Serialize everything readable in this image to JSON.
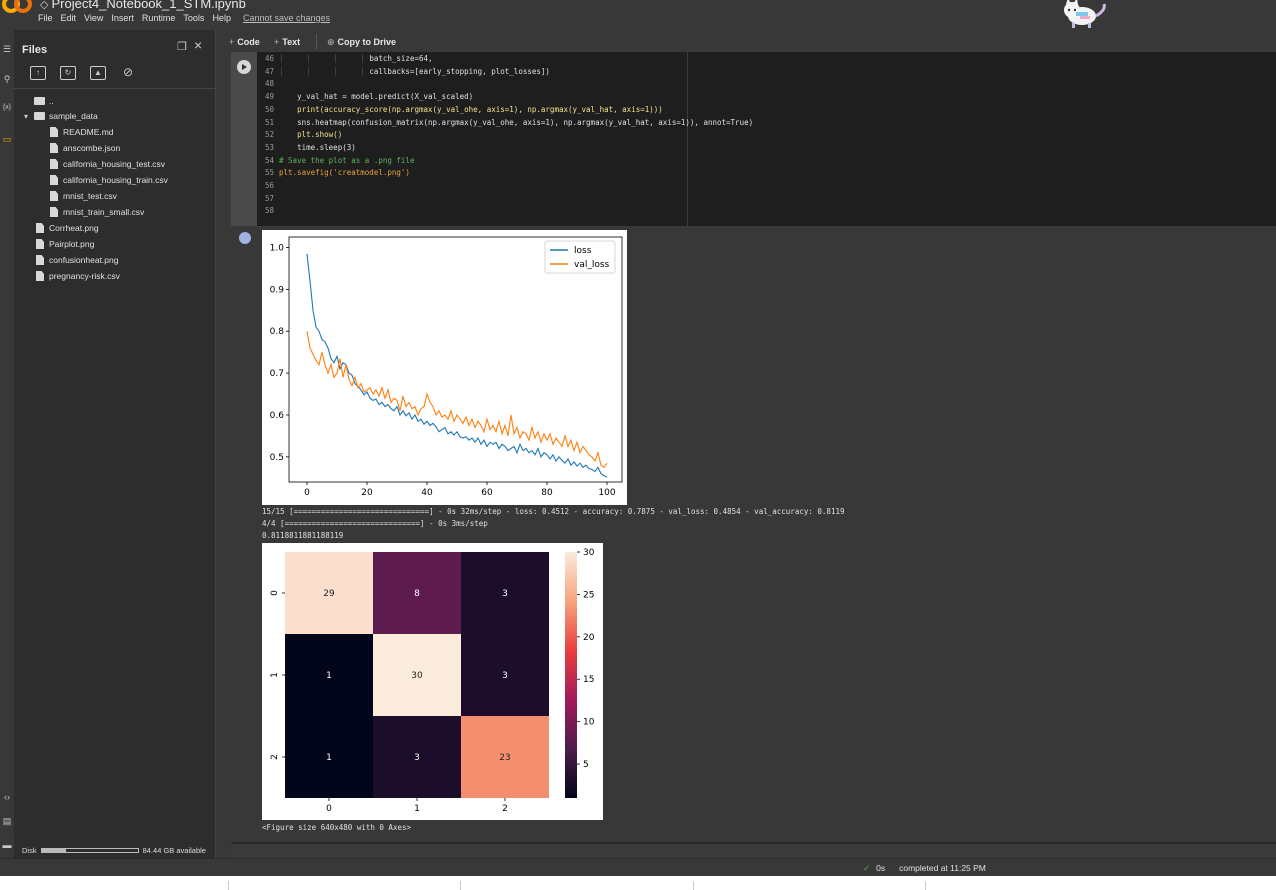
{
  "app": {
    "notebook_title": "Project4_Notebook_1_STM.ipynb",
    "menu": [
      "File",
      "Edit",
      "View",
      "Insert",
      "Runtime",
      "Tools",
      "Help"
    ],
    "save_warning": "Cannot save changes"
  },
  "rail": {
    "items": [
      "☰",
      "⚲",
      "{x}",
      "▭",
      "‹›",
      "▤",
      "▬"
    ]
  },
  "files": {
    "title": "Files",
    "tree": [
      {
        "name": "..",
        "kind": "folder"
      },
      {
        "name": "sample_data",
        "kind": "folder-open"
      },
      {
        "name": "README.md",
        "kind": "file"
      },
      {
        "name": "anscombe.json",
        "kind": "file"
      },
      {
        "name": "california_housing_test.csv",
        "kind": "file"
      },
      {
        "name": "california_housing_train.csv",
        "kind": "file"
      },
      {
        "name": "mnist_test.csv",
        "kind": "file"
      },
      {
        "name": "mnist_train_small.csv",
        "kind": "file"
      },
      {
        "name": "Corrheat.png",
        "kind": "file"
      },
      {
        "name": "Pairplot.png",
        "kind": "file"
      },
      {
        "name": "confusionheat.png",
        "kind": "file"
      },
      {
        "name": "pregnancy-risk.csv",
        "kind": "file"
      }
    ],
    "disk_label": "Disk",
    "disk_available": "84.44 GB available",
    "disk_used_fraction": 0.25
  },
  "toolbar": {
    "code_label": "Code",
    "text_label": "Text",
    "drive_label": "Copy to Drive"
  },
  "code": {
    "lines": [
      {
        "n": "46",
        "text": "batch_size=64,"
      },
      {
        "n": "47",
        "text": "callbacks=[early_stopping, plot_losses])"
      },
      {
        "n": "48",
        "text": ""
      },
      {
        "n": "49",
        "text": "y_val_hat = model.predict(X_val_scaled)"
      },
      {
        "n": "50",
        "text": "print(accuracy_score(np.argmax(y_val_ohe, axis=1), np.argmax(y_val_hat, axis=1)))"
      },
      {
        "n": "51",
        "text": "sns.heatmap(confusion_matrix(np.argmax(y_val_ohe, axis=1), np.argmax(y_val_hat, axis=1)), annot=True)"
      },
      {
        "n": "52",
        "text": "plt.show()"
      },
      {
        "n": "53",
        "text": "time.sleep(3)"
      },
      {
        "n": "54",
        "text": "# Save the plot as a .png file"
      },
      {
        "n": "55",
        "text": "plt.savefig('creatmodel.png')"
      },
      {
        "n": "56",
        "text": ""
      },
      {
        "n": "57",
        "text": ""
      },
      {
        "n": "58",
        "text": ""
      }
    ]
  },
  "output": {
    "line1": "15/15 [==============================] - 0s 32ms/step - loss: 0.4512 - accuracy: 0.7875 - val_loss: 0.4854 - val_accuracy: 0.8119",
    "line2": "4/4 [==============================] - 0s 3ms/step",
    "line3": "0.8118811881188119",
    "line4": "<Figure size 640x480 with 0 Axes>"
  },
  "status": {
    "elapsed": "0s",
    "completed": "completed at 11:25 PM"
  },
  "colors": {
    "loss": "#1f77b4",
    "val_loss": "#ff7f0e",
    "accent_ok": "#4caf50"
  },
  "chart_data": [
    {
      "type": "line",
      "xlim": [
        0,
        100
      ],
      "ylim": [
        0.44,
        1.0
      ],
      "xticks": [
        "0",
        "20",
        "40",
        "60",
        "80",
        "100"
      ],
      "yticks": [
        "0.5",
        "0.6",
        "0.7",
        "0.8",
        "0.9",
        "1.0"
      ],
      "legend": "top-right",
      "series": [
        {
          "name": "loss",
          "color": "#1f77b4",
          "values": [
            0.985,
            0.92,
            0.85,
            0.81,
            0.8,
            0.78,
            0.775,
            0.76,
            0.735,
            0.725,
            0.74,
            0.71,
            0.725,
            0.72,
            0.7,
            0.695,
            0.675,
            0.668,
            0.66,
            0.648,
            0.655,
            0.64,
            0.635,
            0.638,
            0.625,
            0.63,
            0.62,
            0.625,
            0.615,
            0.61,
            0.62,
            0.6,
            0.61,
            0.598,
            0.605,
            0.59,
            0.6,
            0.585,
            0.59,
            0.578,
            0.585,
            0.575,
            0.58,
            0.572,
            0.56,
            0.565,
            0.57,
            0.555,
            0.56,
            0.552,
            0.56,
            0.548,
            0.545,
            0.548,
            0.54,
            0.545,
            0.535,
            0.545,
            0.53,
            0.54,
            0.525,
            0.535,
            0.53,
            0.535,
            0.52,
            0.53,
            0.525,
            0.515,
            0.52,
            0.525,
            0.51,
            0.53,
            0.515,
            0.52,
            0.51,
            0.515,
            0.505,
            0.52,
            0.5,
            0.51,
            0.505,
            0.495,
            0.505,
            0.49,
            0.5,
            0.492,
            0.485,
            0.495,
            0.48,
            0.488,
            0.478,
            0.485,
            0.475,
            0.48,
            0.472,
            0.47,
            0.465,
            0.475,
            0.46,
            0.455,
            0.452
          ]
        },
        {
          "name": "val_loss",
          "color": "#ff7f0e",
          "values": [
            0.8,
            0.76,
            0.745,
            0.73,
            0.72,
            0.75,
            0.72,
            0.7,
            0.72,
            0.69,
            0.7,
            0.735,
            0.69,
            0.72,
            0.685,
            0.67,
            0.69,
            0.665,
            0.675,
            0.655,
            0.66,
            0.665,
            0.65,
            0.66,
            0.645,
            0.665,
            0.64,
            0.66,
            0.63,
            0.64,
            0.635,
            0.61,
            0.645,
            0.62,
            0.63,
            0.615,
            0.62,
            0.6,
            0.615,
            0.62,
            0.65,
            0.63,
            0.62,
            0.6,
            0.61,
            0.595,
            0.6,
            0.59,
            0.61,
            0.585,
            0.6,
            0.59,
            0.58,
            0.595,
            0.575,
            0.59,
            0.57,
            0.585,
            0.575,
            0.56,
            0.59,
            0.565,
            0.575,
            0.56,
            0.585,
            0.555,
            0.575,
            0.55,
            0.6,
            0.555,
            0.57,
            0.545,
            0.56,
            0.555,
            0.54,
            0.57,
            0.545,
            0.56,
            0.535,
            0.555,
            0.54,
            0.555,
            0.53,
            0.545,
            0.535,
            0.525,
            0.55,
            0.525,
            0.54,
            0.515,
            0.535,
            0.51,
            0.525,
            0.515,
            0.505,
            0.5,
            0.49,
            0.51,
            0.48,
            0.475,
            0.485
          ]
        }
      ]
    },
    {
      "type": "heatmap",
      "x_categories": [
        "0",
        "1",
        "2"
      ],
      "y_categories": [
        "0",
        "1",
        "2"
      ],
      "values": [
        [
          29,
          8,
          3
        ],
        [
          1,
          30,
          3
        ],
        [
          1,
          3,
          23
        ]
      ],
      "colorbar_ticks": [
        "5",
        "10",
        "15",
        "20",
        "25",
        "30"
      ],
      "vmin": 1,
      "vmax": 30
    }
  ]
}
